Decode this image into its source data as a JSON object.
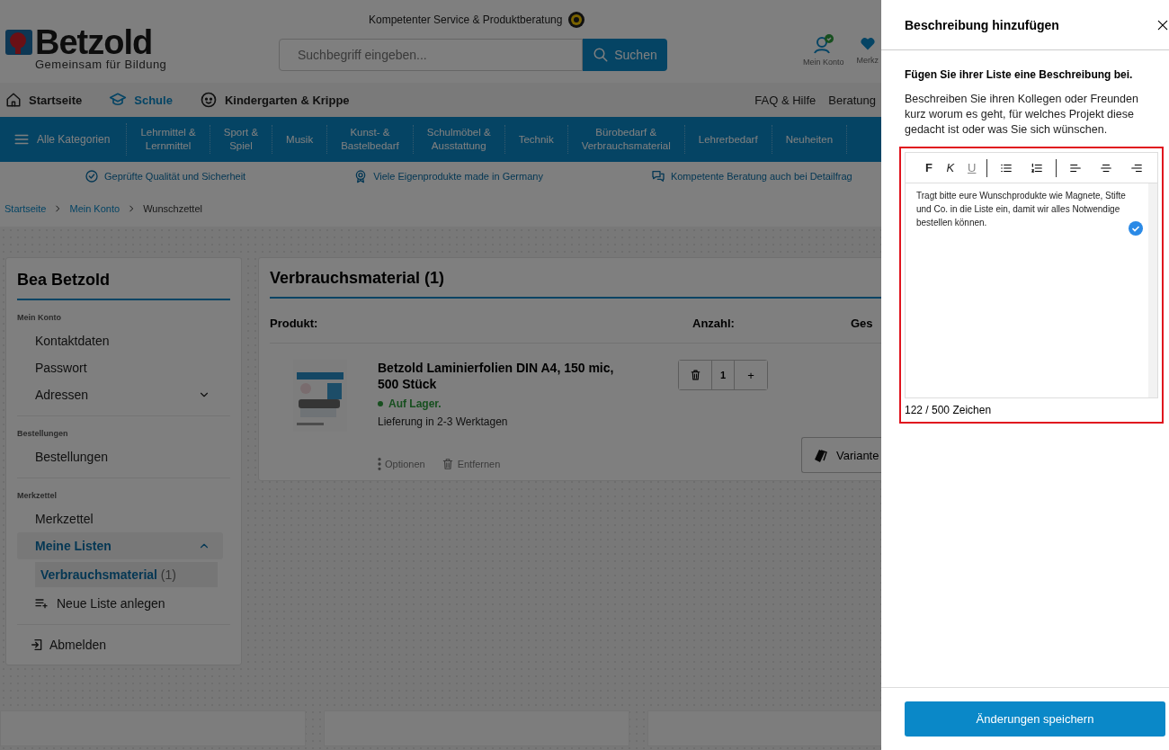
{
  "header": {
    "service_note": "Kompetenter Service & Produktberatung",
    "logo": {
      "name": "Betzold",
      "tagline": "Gemeinsam für Bildung"
    },
    "search": {
      "placeholder": "Suchbegriff eingeben...",
      "button": "Suchen"
    },
    "account_links": [
      {
        "label": "Mein Konto",
        "kind": "account"
      },
      {
        "label": "Merkz",
        "kind": "wishlist"
      }
    ]
  },
  "main_nav": {
    "items": [
      {
        "label": "Startseite",
        "kind": "home",
        "selected": false
      },
      {
        "label": "Schule",
        "kind": "school",
        "selected": true
      },
      {
        "label": "Kindergarten & Krippe",
        "kind": "kids",
        "selected": false
      }
    ],
    "links": [
      "FAQ & Hilfe",
      "Beratung"
    ]
  },
  "category_bar": {
    "menu_label": "Alle Kategorien",
    "categories": [
      "Lehrmittel &\nLernmittel",
      "Sport &\nSpiel",
      "Musik",
      "Kunst- &\nBastelbedarf",
      "Schulmöbel &\nAusstattung",
      "Technik",
      "Bürobedarf &\nVerbrauchsmaterial",
      "Lehrerbedarf",
      "Neuheiten"
    ]
  },
  "usp": [
    {
      "label": "Geprüfte Qualität und Sicherheit",
      "kind": "check"
    },
    {
      "label": "Viele Eigenprodukte made in Germany",
      "kind": "seal"
    },
    {
      "label": "Kompetente Beratung auch bei Detailfrag",
      "kind": "chat"
    }
  ],
  "breadcrumb": [
    {
      "label": "Startseite",
      "link": true
    },
    {
      "label": "Mein Konto",
      "link": true
    },
    {
      "label": "Wunschzettel",
      "link": false
    }
  ],
  "sidebar": {
    "title": "Bea Betzold",
    "sections": [
      {
        "heading": "Mein Konto",
        "items": [
          {
            "label": "Kontaktdaten",
            "kind": "link"
          },
          {
            "label": "Passwort",
            "kind": "link"
          },
          {
            "label": "Adressen",
            "kind": "expandable",
            "expanded": false
          }
        ]
      },
      {
        "heading": "Bestellungen",
        "items": [
          {
            "label": "Bestellungen",
            "kind": "link"
          }
        ]
      },
      {
        "heading": "Merkzettel",
        "items": [
          {
            "label": "Merkzettel",
            "kind": "link"
          },
          {
            "label": "Meine Listen",
            "kind": "expandable",
            "expanded": true,
            "children": [
              {
                "label": "Verbrauchsmaterial",
                "count": "(1)",
                "selected": true
              }
            ]
          },
          {
            "label": "Neue Liste anlegen",
            "kind": "add"
          }
        ]
      }
    ],
    "logout": "Abmelden"
  },
  "list": {
    "title": "Verbrauchsmaterial (1)",
    "columns": [
      "Produkt:",
      "Anzahl:",
      "Ges"
    ],
    "items": [
      {
        "kind": "picture",
        "name": "Betzold Laminierfolien DIN A4, 150 mic, 500 Stück",
        "stock": "Auf Lager.",
        "in_stock": true,
        "delivery": "Lieferung in 2-3 Werktagen",
        "quantity": "1",
        "increment": "+",
        "actions": [
          {
            "label": "Optionen",
            "kind": "options"
          },
          {
            "label": "Entfernen",
            "kind": "remove"
          }
        ],
        "variant_button": "Variante"
      }
    ]
  },
  "drawer": {
    "title": "Beschreibung hinzufügen",
    "lead": "Fügen Sie ihrer Liste eine Beschreibung bei.",
    "hint": "Beschreiben Sie ihren Kollegen oder Freunden kurz worum es geht, für welches Projekt diese gedacht ist oder was Sie sich wünschen.",
    "editor": {
      "highlighted": true,
      "toolbar": [
        {
          "kind": "bold",
          "label": "F"
        },
        {
          "kind": "italic",
          "label": "K"
        },
        {
          "kind": "underline",
          "label": "U"
        },
        {
          "kind": "divider"
        },
        {
          "kind": "bullets"
        },
        {
          "kind": "numbers"
        },
        {
          "kind": "divider"
        },
        {
          "kind": "left"
        },
        {
          "kind": "center"
        },
        {
          "kind": "right"
        }
      ],
      "value": "Tragt bitte eure Wunschprodukte wie Magnete, Stifte und Co. in die Liste ein, damit wir alles Notwendige bestellen können.",
      "validated": true,
      "counter": "122 / 500 Zeichen"
    },
    "save_button": "Änderungen speichern"
  }
}
